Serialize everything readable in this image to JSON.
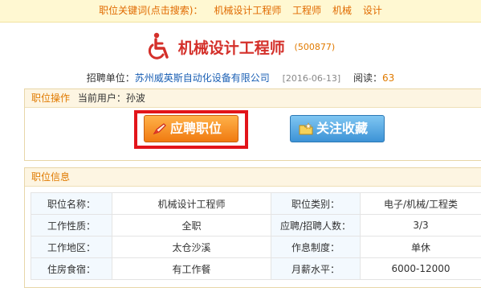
{
  "keyword_bar": {
    "label": "职位关键词(点击搜索)：",
    "keywords": [
      "机械设计工程师",
      "工程师",
      "机械",
      "设计"
    ]
  },
  "job": {
    "icon": "wheelchair-icon",
    "title": "机械设计工程师",
    "id": "(500877)"
  },
  "meta": {
    "company_label": "招聘单位：",
    "company": "苏州威英斯自动化设备有限公司",
    "date": "[2016-06-13]",
    "read_label": "阅读：",
    "read_count": "63"
  },
  "ops": {
    "heading": "职位操作",
    "user_label": "当前用户：",
    "user": "孙波",
    "apply_label": "应聘职位",
    "favorite_label": "关注收藏"
  },
  "info": {
    "heading": "职位信息",
    "rows": [
      [
        "职位名称：",
        "机械设计工程师",
        "职位类别：",
        "电子/机械/工程类"
      ],
      [
        "工作性质：",
        "全职",
        "应聘/招聘人数：",
        "3/3"
      ],
      [
        "工作地区：",
        "太仓沙溪",
        "作息制度：",
        "单休"
      ],
      [
        "住房食宿：",
        "有工作餐",
        "月薪水平：",
        "6000-12000"
      ]
    ]
  },
  "colors": {
    "accent_orange": "#e07a00",
    "title_red": "#d4302a",
    "highlight_red": "#e2141a",
    "link_blue": "#1a5fb4"
  }
}
